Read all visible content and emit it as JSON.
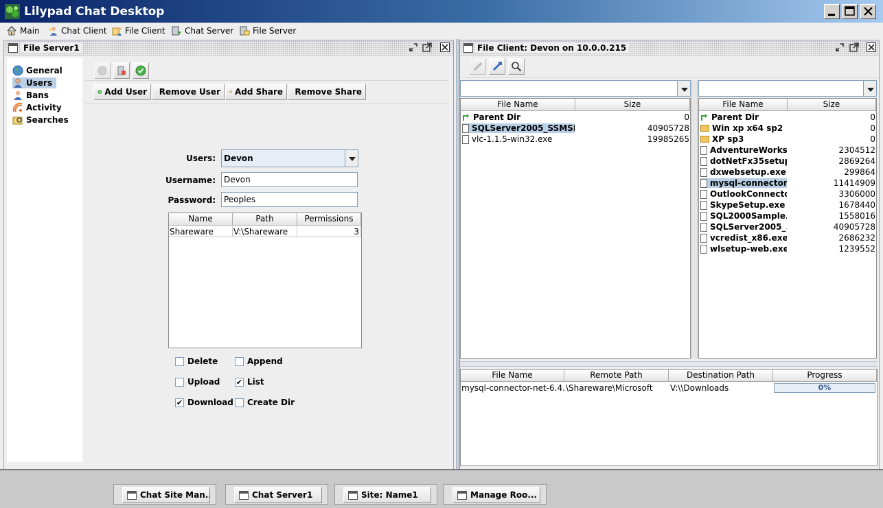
{
  "window": {
    "title": "Lilypad Chat Desktop"
  },
  "menu": [
    {
      "label": "Main",
      "icon": "home-icon"
    },
    {
      "label": "Chat Client",
      "icon": "chat-client-icon"
    },
    {
      "label": "File Client",
      "icon": "file-client-icon"
    },
    {
      "label": "Chat Server",
      "icon": "chat-server-icon"
    },
    {
      "label": "File Server",
      "icon": "file-server-icon"
    }
  ],
  "file_server": {
    "title": "File Server1",
    "nav": [
      {
        "label": "General",
        "icon": "globe-icon"
      },
      {
        "label": "Users",
        "icon": "user-icon",
        "selected": true
      },
      {
        "label": "Bans",
        "icon": "ban-icon"
      },
      {
        "label": "Activity",
        "icon": "activity-icon"
      },
      {
        "label": "Searches",
        "icon": "search-folder-icon"
      }
    ],
    "actions": {
      "add_user": "Add User",
      "remove_user": "Remove User",
      "add_share": "Add Share",
      "remove_share": "Remove Share"
    },
    "form": {
      "users_label": "Users:",
      "users_value": "Devon",
      "username_label": "Username:",
      "username_value": "Devon",
      "password_label": "Password:",
      "password_value": "Peoples"
    },
    "shares_table": {
      "columns": [
        "Name",
        "Path",
        "Permissions"
      ],
      "rows": [
        [
          "Shareware",
          "V:\\Shareware",
          "3"
        ]
      ]
    },
    "permissions": {
      "delete": {
        "label": "Delete",
        "checked": false
      },
      "append": {
        "label": "Append",
        "checked": false
      },
      "upload": {
        "label": "Upload",
        "checked": false
      },
      "list": {
        "label": "List",
        "checked": true
      },
      "download": {
        "label": "Download",
        "checked": true
      },
      "create_dir": {
        "label": "Create Dir",
        "checked": false
      }
    },
    "check_mark": "✔"
  },
  "file_client": {
    "title": "File Client: Devon on 10.0.0.215",
    "left_list": {
      "columns": [
        "File Name",
        "Size"
      ],
      "rows": [
        {
          "name": "Parent Dir",
          "size": "0",
          "type": "updir"
        },
        {
          "name": "SQLServer2005_SSMSE...",
          "size": "40905728",
          "type": "file",
          "selected": true
        },
        {
          "name": "vlc-1.1.5-win32.exe",
          "size": "19985265",
          "type": "file"
        }
      ]
    },
    "right_list": {
      "columns": [
        "File Name",
        "Size"
      ],
      "rows": [
        {
          "name": "Parent Dir",
          "size": "0",
          "type": "updir"
        },
        {
          "name": "Win xp x64 sp2",
          "size": "0",
          "type": "folder"
        },
        {
          "name": "XP sp3",
          "size": "0",
          "type": "folder"
        },
        {
          "name": "AdventureWorks...",
          "size": "2304512",
          "type": "file"
        },
        {
          "name": "dotNetFx35setup....",
          "size": "2869264",
          "type": "file"
        },
        {
          "name": "dxwebsetup.exe",
          "size": "299864",
          "type": "file"
        },
        {
          "name": "mysql-connector-...",
          "size": "11414909",
          "type": "file",
          "selected": true
        },
        {
          "name": "OutlookConnecto...",
          "size": "3306000",
          "type": "file"
        },
        {
          "name": "SkypeSetup.exe",
          "size": "1678440",
          "type": "file"
        },
        {
          "name": "SQL2000Sample...",
          "size": "1558016",
          "type": "file"
        },
        {
          "name": "SQLServer2005_...",
          "size": "40905728",
          "type": "file"
        },
        {
          "name": "vcredist_x86.exe",
          "size": "2686232",
          "type": "file"
        },
        {
          "name": "wlsetup-web.exe",
          "size": "1239552",
          "type": "file"
        }
      ]
    },
    "transfers": {
      "columns": [
        "File Name",
        "Remote Path",
        "Destination Path",
        "Progress"
      ],
      "rows": [
        {
          "file": "mysql-connector-net-6.4....",
          "remote": "\\Shareware\\Microsoft",
          "dest": "V:\\\\Downloads",
          "progress_label": "0%",
          "progress": 0
        }
      ]
    }
  },
  "taskbar": [
    {
      "label": "Chat Site Man..."
    },
    {
      "label": "Chat Server1"
    },
    {
      "label": "Site: Name1"
    },
    {
      "label": "Manage Roo..."
    }
  ],
  "colors": {
    "title_start": "#0a246a",
    "title_end": "#a6caf0",
    "selection": "#b8cfe5"
  }
}
